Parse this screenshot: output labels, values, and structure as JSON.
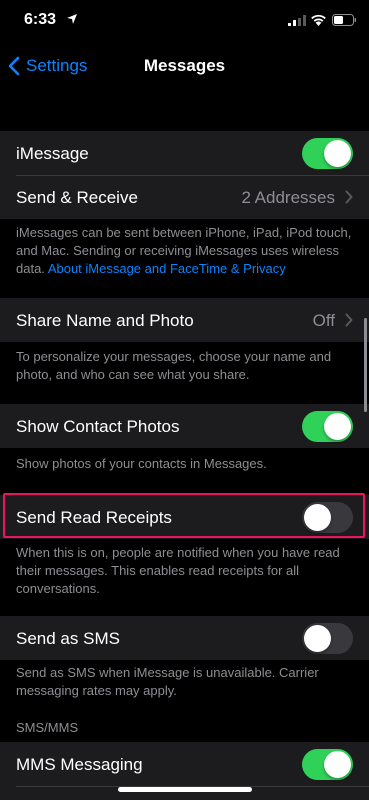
{
  "status": {
    "time": "6:33"
  },
  "nav": {
    "back_label": "Settings",
    "title": "Messages"
  },
  "imessage": {
    "label": "iMessage",
    "on": true
  },
  "send_receive": {
    "label": "Send & Receive",
    "value": "2 Addresses"
  },
  "imessage_footer": {
    "text": "iMessages can be sent between iPhone, iPad, iPod touch, and Mac. Sending or receiving iMessages uses wireless data. ",
    "link": "About iMessage and FaceTime & Privacy"
  },
  "share_name": {
    "label": "Share Name and Photo",
    "value": "Off"
  },
  "share_footer": "To personalize your messages, choose your name and photo, and who can see what you share.",
  "contact_photos": {
    "label": "Show Contact Photos",
    "on": true
  },
  "contact_photos_footer": "Show photos of your contacts in Messages.",
  "read_receipts": {
    "label": "Send Read Receipts",
    "on": false
  },
  "read_receipts_footer": "When this is on, people are notified when you have read their messages. This enables read receipts for all conversations.",
  "send_sms": {
    "label": "Send as SMS",
    "on": false
  },
  "send_sms_footer": "Send as SMS when iMessage is unavailable. Carrier messaging rates may apply.",
  "sms_mms_header": "SMS/MMS",
  "mms": {
    "label": "MMS Messaging",
    "on": true
  },
  "colors": {
    "accent": "#0a84ff",
    "toggle_on": "#30d158",
    "highlight": "#e8175d",
    "cell_bg": "#1c1c1e"
  },
  "icons": [
    "location-arrow-icon",
    "cellular-signal-icon",
    "wifi-icon",
    "battery-icon",
    "chevron-left-icon",
    "chevron-right-icon"
  ]
}
